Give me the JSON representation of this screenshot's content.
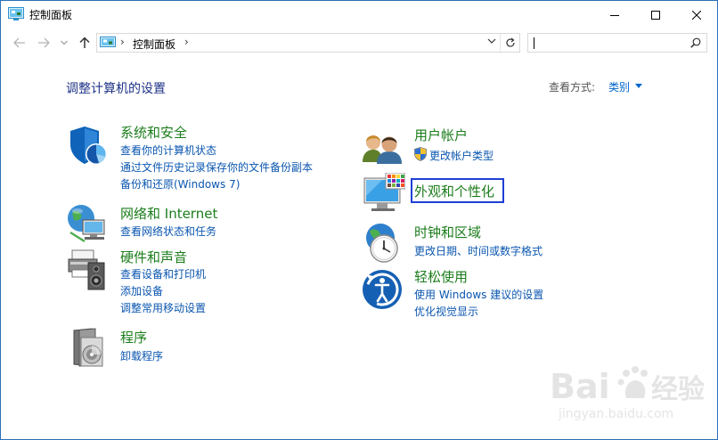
{
  "window": {
    "title": "控制面板"
  },
  "address": {
    "crumb": "控制面板",
    "separator": "›"
  },
  "search": {
    "value": "",
    "placeholder": ""
  },
  "main": {
    "heading": "调整计算机的设置",
    "view_by_label": "查看方式:",
    "view_by_value": "类别"
  },
  "categories": {
    "security": {
      "title": "系统和安全",
      "links": [
        "查看你的计算机状态",
        "通过文件历史记录保存你的文件备份副本",
        "备份和还原(Windows 7)"
      ]
    },
    "network": {
      "title": "网络和 Internet",
      "links": [
        "查看网络状态和任务"
      ]
    },
    "hardware": {
      "title": "硬件和声音",
      "links": [
        "查看设备和打印机",
        "添加设备",
        "调整常用移动设置"
      ]
    },
    "programs": {
      "title": "程序",
      "links": [
        "卸载程序"
      ]
    },
    "accounts": {
      "title": "用户帐户",
      "links": [
        "更改帐户类型"
      ]
    },
    "appearance": {
      "title": "外观和个性化",
      "links": []
    },
    "clock": {
      "title": "时钟和区域",
      "links": [
        "更改日期、时间或数字格式"
      ]
    },
    "ease": {
      "title": "轻松使用",
      "links": [
        "使用 Windows 建议的设置",
        "优化视觉显示"
      ]
    }
  },
  "colors": {
    "heading": "#1e3287",
    "category_title": "#1b7d1b",
    "link": "#0a56b0",
    "highlight": "#1f3fd6"
  }
}
